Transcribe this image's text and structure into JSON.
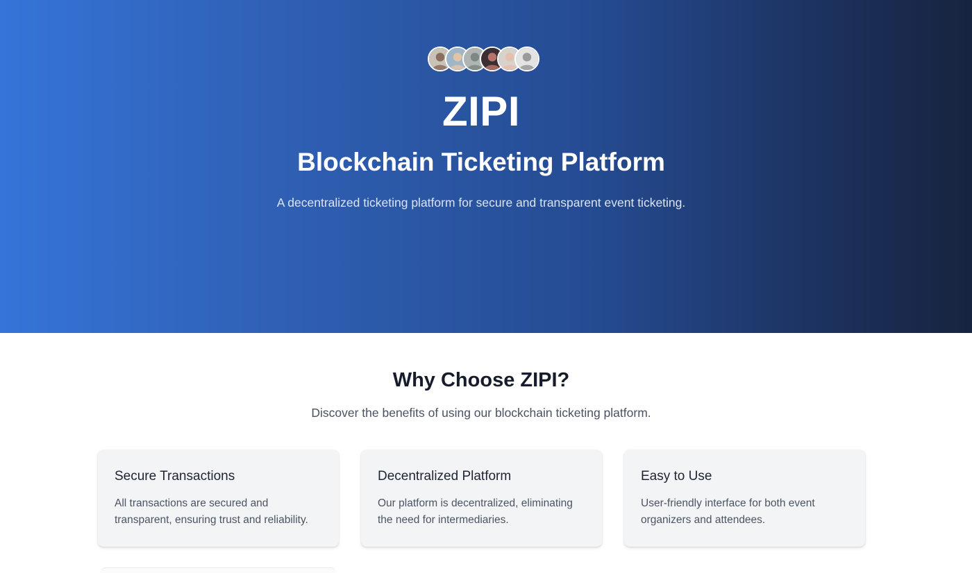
{
  "hero": {
    "avatars": [
      {
        "name": "avatar-1",
        "bg": "#c9c2b7",
        "skin": "#8a6f5e"
      },
      {
        "name": "avatar-2",
        "bg": "#9fb6c9",
        "skin": "#e2c3a8"
      },
      {
        "name": "avatar-3",
        "bg": "#aeb5b3",
        "skin": "#7d8784"
      },
      {
        "name": "avatar-4",
        "bg": "#3b2f33",
        "skin": "#b7746b"
      },
      {
        "name": "avatar-5",
        "bg": "#d8d2cd",
        "skin": "#e6c0ae"
      },
      {
        "name": "avatar-6",
        "bg": "#e3e3e3",
        "skin": "#9a9a9a"
      }
    ],
    "title": "ZIPI",
    "subtitle": "Blockchain Ticketing Platform",
    "description": "A decentralized ticketing platform for secure and transparent event ticketing."
  },
  "features": {
    "title": "Why Choose ZIPI?",
    "subtitle": "Discover the benefits of using our blockchain ticketing platform.",
    "cards": [
      {
        "title": "Secure Transactions",
        "text": "All transactions are secured and transparent, ensuring trust and reliability."
      },
      {
        "title": "Decentralized Platform",
        "text": "Our platform is decentralized, eliminating the need for intermediaries."
      },
      {
        "title": "Easy to Use",
        "text": "User-friendly interface for both event organizers and attendees."
      }
    ]
  },
  "colors": {
    "hero_gradient_start": "#3574d8",
    "hero_gradient_end": "#172440",
    "card_background": "#f3f4f6",
    "heading_dark": "#161c2b"
  }
}
